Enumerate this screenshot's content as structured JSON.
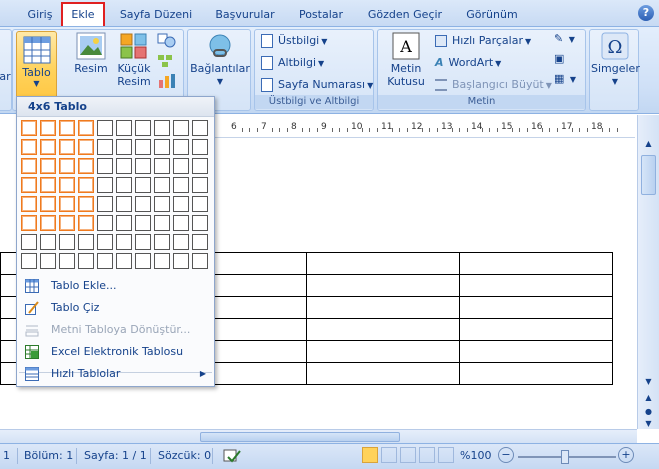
{
  "tabs": [
    {
      "label": "Giriş",
      "active": false
    },
    {
      "label": "Ekle",
      "active": true
    },
    {
      "label": "Sayfa Düzeni",
      "active": false
    },
    {
      "label": "Başvurular",
      "active": false
    },
    {
      "label": "Postalar",
      "active": false
    },
    {
      "label": "Gözden Geçir",
      "active": false
    },
    {
      "label": "Görünüm",
      "active": false
    }
  ],
  "help_label": "?",
  "ribbon": {
    "partial_button_label": "ar",
    "table_button_label": "Tablo",
    "picture_label": "Resim",
    "clipart_label": "Küçük\nResim",
    "links_label": "Bağlantılar",
    "header_footer": {
      "label": "Üstbilgi ve Altbilgi",
      "header_label": "Üstbilgi",
      "footer_label": "Altbilgi",
      "page_number_label": "Sayfa Numarası"
    },
    "text": {
      "label": "Metin",
      "textbox_label": "Metin\nKutusu",
      "quick_parts_label": "Hızlı Parçalar",
      "wordart_label": "WordArt",
      "dropcap_label": "Başlangıcı Büyüt"
    },
    "symbols_label": "Simgeler"
  },
  "table_dropdown": {
    "title": "4x6 Tablo",
    "grid_columns": 10,
    "grid_rows": 8,
    "selected_columns": 4,
    "selected_rows": 6,
    "items": [
      {
        "label": "Tablo Ekle...",
        "enabled": true,
        "icon": "insert-table-icon"
      },
      {
        "label": "Tablo Çiz",
        "enabled": true,
        "icon": "draw-table-icon"
      },
      {
        "label": "Metni Tabloya Dönüştür...",
        "enabled": false,
        "icon": "convert-text-icon"
      },
      {
        "label": "Excel Elektronik Tablosu",
        "enabled": true,
        "icon": "excel-icon"
      },
      {
        "label": "Hızlı Tablolar",
        "enabled": true,
        "icon": "quick-tables-icon",
        "submenu": true
      }
    ]
  },
  "ruler_numbers": [
    "6",
    "7",
    "8",
    "9",
    "10",
    "11",
    "12",
    "13",
    "14",
    "15",
    "16",
    "17",
    "18"
  ],
  "status_bar": {
    "page_number": "1",
    "section": "Bölüm: 1",
    "page": "Sayfa: 1 / 1",
    "words": "Sözcük: 0",
    "zoom": "%100"
  },
  "colors": {
    "accent": "#15428b",
    "selection_border": "#ef7a1e",
    "highlight_tab_border": "#e02020"
  }
}
